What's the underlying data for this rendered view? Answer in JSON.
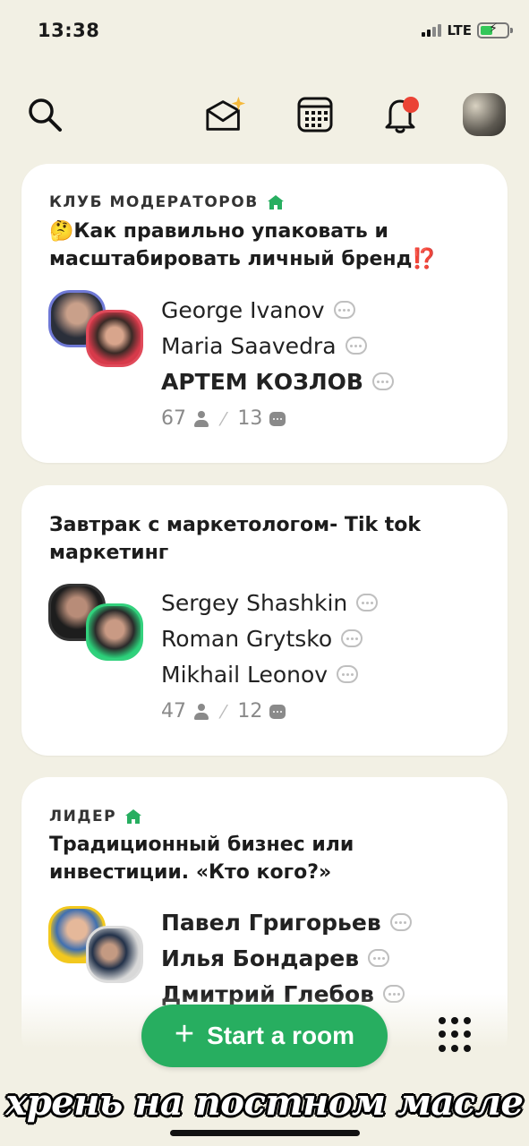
{
  "status": {
    "time": "13:38",
    "network": "LTE"
  },
  "toolbar": {
    "icons": [
      "search-icon",
      "invite-envelope-icon",
      "calendar-icon",
      "bell-icon",
      "profile-avatar"
    ],
    "notification_color": "#EB4335"
  },
  "rooms": [
    {
      "club": "КЛУБ МОДЕРАТОРОВ",
      "title": "🤔Как правильно упаковать и масштабировать личный бренд⁉️",
      "speakers": [
        {
          "name": "George Ivanov",
          "bold": false
        },
        {
          "name": "Maria Saavedra",
          "bold": false
        },
        {
          "name": "АРТЕМ КОЗЛОВ",
          "bold": true
        }
      ],
      "listeners": "67",
      "speakers_count": "13"
    },
    {
      "club": "",
      "title": "Завтрак с маркетологом- Tik tok маркетинг",
      "speakers": [
        {
          "name": "Sergey Shashkin",
          "bold": false
        },
        {
          "name": "Roman Grytsko",
          "bold": false
        },
        {
          "name": "Mikhail Leonov",
          "bold": false
        }
      ],
      "listeners": "47",
      "speakers_count": "12"
    },
    {
      "club": "ЛИДЕР",
      "title": "Традиционный бизнес или инвестиции. «Кто кого?»",
      "speakers": [
        {
          "name": "Павел Григорьев",
          "bold": true
        },
        {
          "name": "Илья Бондарев",
          "bold": true
        },
        {
          "name": "Дмитрий Глебов",
          "bold": true
        }
      ]
    }
  ],
  "start_room": {
    "label": "Start a room"
  },
  "caption": "хрень на постном масле",
  "colors": {
    "background": "#F2F0E4",
    "accent": "#27AE60",
    "card": "#FFFFFF"
  }
}
